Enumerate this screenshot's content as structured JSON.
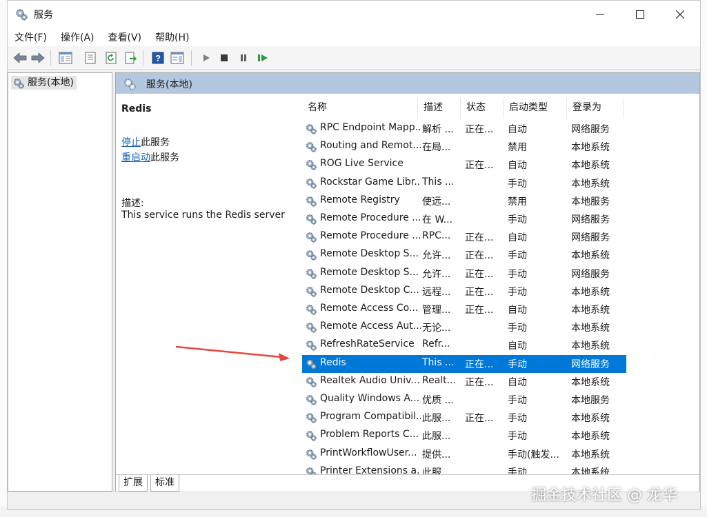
{
  "window": {
    "title": "服务"
  },
  "menubar": {
    "items": [
      {
        "label": "文件(F)"
      },
      {
        "label": "操作(A)"
      },
      {
        "label": "查看(V)"
      },
      {
        "label": "帮助(H)"
      }
    ]
  },
  "tree": {
    "root_label": "服务(本地)"
  },
  "main": {
    "header_label": "服务(本地)",
    "service_name": "Redis",
    "stop_link": "停止",
    "stop_suffix": "此服务",
    "restart_link": "重启动",
    "restart_suffix": "此服务",
    "desc_label": "描述:",
    "desc_text": "This service runs the Redis server"
  },
  "table": {
    "columns": [
      "名称",
      "描述",
      "状态",
      "启动类型",
      "登录为"
    ],
    "rows": [
      {
        "name": "RPC Endpoint Mapp...",
        "desc": "解析 ...",
        "status": "正在...",
        "startup": "自动",
        "logon": "网络服务"
      },
      {
        "name": "Routing and Remot...",
        "desc": "在局...",
        "status": "",
        "startup": "禁用",
        "logon": "本地系统"
      },
      {
        "name": "ROG Live Service",
        "desc": "",
        "status": "正在...",
        "startup": "自动",
        "logon": "本地系统"
      },
      {
        "name": "Rockstar Game Libr...",
        "desc": "This ...",
        "status": "",
        "startup": "手动",
        "logon": "本地系统"
      },
      {
        "name": "Remote Registry",
        "desc": "使远...",
        "status": "",
        "startup": "禁用",
        "logon": "本地服务"
      },
      {
        "name": "Remote Procedure ...",
        "desc": "在 W...",
        "status": "",
        "startup": "手动",
        "logon": "网络服务"
      },
      {
        "name": "Remote Procedure ...",
        "desc": "RPC...",
        "status": "正在...",
        "startup": "自动",
        "logon": "网络服务"
      },
      {
        "name": "Remote Desktop S...",
        "desc": "允许...",
        "status": "正在...",
        "startup": "手动",
        "logon": "本地系统"
      },
      {
        "name": "Remote Desktop S...",
        "desc": "允许...",
        "status": "正在...",
        "startup": "手动",
        "logon": "网络服务"
      },
      {
        "name": "Remote Desktop C...",
        "desc": "远程...",
        "status": "正在...",
        "startup": "手动",
        "logon": "本地系统"
      },
      {
        "name": "Remote Access Co...",
        "desc": "管理...",
        "status": "正在...",
        "startup": "自动",
        "logon": "本地系统"
      },
      {
        "name": "Remote Access Aut...",
        "desc": "无论...",
        "status": "",
        "startup": "手动",
        "logon": "本地系统"
      },
      {
        "name": "RefreshRateService",
        "desc": "Refr...",
        "status": "",
        "startup": "自动",
        "logon": "本地系统"
      },
      {
        "name": "Redis",
        "desc": "This ...",
        "status": "正在...",
        "startup": "手动",
        "logon": "网络服务"
      },
      {
        "name": "Realtek Audio Univ...",
        "desc": "Realt...",
        "status": "正在...",
        "startup": "自动",
        "logon": "本地系统"
      },
      {
        "name": "Quality Windows A...",
        "desc": "优质 ...",
        "status": "",
        "startup": "手动",
        "logon": "本地服务"
      },
      {
        "name": "Program Compatibil...",
        "desc": "此服...",
        "status": "正在...",
        "startup": "手动",
        "logon": "本地系统"
      },
      {
        "name": "Problem Reports C...",
        "desc": "此服...",
        "status": "",
        "startup": "手动",
        "logon": "本地系统"
      },
      {
        "name": "PrintWorkflowUser...",
        "desc": "提供...",
        "status": "",
        "startup": "手动(触发...",
        "logon": "本地系统"
      },
      {
        "name": "Printer Extensions a...",
        "desc": "此服...",
        "status": "",
        "startup": "手动",
        "logon": "本地系统"
      }
    ]
  },
  "tabs": [
    {
      "label": "扩展"
    },
    {
      "label": "标准"
    }
  ],
  "watermark": "掘金技术社区 @ 龙华",
  "colors": {
    "selection": "#0078d7",
    "header_band": "#b3c8de",
    "link": "#1a5fb4",
    "arrow": "#e8453c"
  }
}
